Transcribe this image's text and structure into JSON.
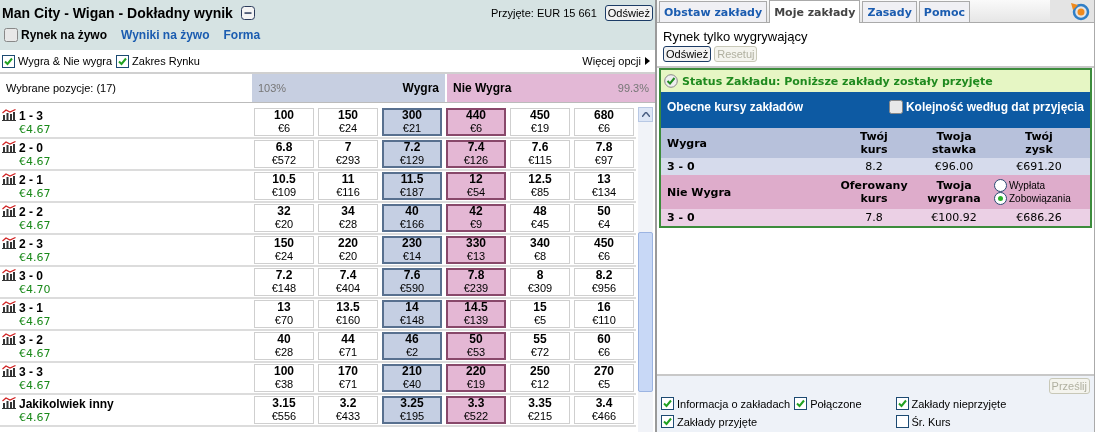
{
  "market": {
    "title": "Man City - Wigan - Dokładny wynik",
    "matched": "Przyjęte: EUR 15 661",
    "refresh": "Odśwież"
  },
  "live": {
    "label": "Rynek na żywo",
    "checked": false
  },
  "links": [
    "Wyniki na żywo",
    "Forma"
  ],
  "filters": [
    {
      "label": "Wygra & Nie wygra",
      "checked": true
    },
    {
      "label": "Zakres Rynku",
      "checked": true
    }
  ],
  "more_options": "Więcej opcji",
  "header": {
    "selections": "Wybrane pozycje:  (17)",
    "back_percent": "103%",
    "back": "Wygra",
    "lay": "Nie Wygra",
    "lay_percent": "99.3%"
  },
  "rows": [
    {
      "name": "1 - 3",
      "total": "€4.67",
      "cells": [
        [
          "100",
          "€6"
        ],
        [
          "150",
          "€24"
        ],
        [
          "300",
          "€21"
        ],
        [
          "440",
          "€6"
        ],
        [
          "450",
          "€19"
        ],
        [
          "680",
          "€6"
        ]
      ]
    },
    {
      "name": "2 - 0",
      "total": "€4.67",
      "cells": [
        [
          "6.8",
          "€572"
        ],
        [
          "7",
          "€293"
        ],
        [
          "7.2",
          "€129"
        ],
        [
          "7.4",
          "€126"
        ],
        [
          "7.6",
          "€115"
        ],
        [
          "7.8",
          "€97"
        ]
      ]
    },
    {
      "name": "2 - 1",
      "total": "€4.67",
      "cells": [
        [
          "10.5",
          "€109"
        ],
        [
          "11",
          "€116"
        ],
        [
          "11.5",
          "€187"
        ],
        [
          "12",
          "€54"
        ],
        [
          "12.5",
          "€85"
        ],
        [
          "13",
          "€134"
        ]
      ]
    },
    {
      "name": "2 - 2",
      "total": "€4.67",
      "cells": [
        [
          "32",
          "€20"
        ],
        [
          "34",
          "€28"
        ],
        [
          "40",
          "€166"
        ],
        [
          "42",
          "€9"
        ],
        [
          "48",
          "€45"
        ],
        [
          "50",
          "€4"
        ]
      ]
    },
    {
      "name": "2 - 3",
      "total": "€4.67",
      "cells": [
        [
          "150",
          "€24"
        ],
        [
          "220",
          "€20"
        ],
        [
          "230",
          "€14"
        ],
        [
          "330",
          "€13"
        ],
        [
          "340",
          "€8"
        ],
        [
          "450",
          "€6"
        ]
      ]
    },
    {
      "name": "3 - 0",
      "total": "€4.70",
      "cells": [
        [
          "7.2",
          "€148"
        ],
        [
          "7.4",
          "€404"
        ],
        [
          "7.6",
          "€590"
        ],
        [
          "7.8",
          "€239"
        ],
        [
          "8",
          "€309"
        ],
        [
          "8.2",
          "€956"
        ]
      ]
    },
    {
      "name": "3 - 1",
      "total": "€4.67",
      "cells": [
        [
          "13",
          "€70"
        ],
        [
          "13.5",
          "€160"
        ],
        [
          "14",
          "€148"
        ],
        [
          "14.5",
          "€139"
        ],
        [
          "15",
          "€5"
        ],
        [
          "16",
          "€110"
        ]
      ]
    },
    {
      "name": "3 - 2",
      "total": "€4.67",
      "cells": [
        [
          "40",
          "€28"
        ],
        [
          "44",
          "€71"
        ],
        [
          "46",
          "€2"
        ],
        [
          "50",
          "€53"
        ],
        [
          "55",
          "€72"
        ],
        [
          "60",
          "€6"
        ]
      ]
    },
    {
      "name": "3 - 3",
      "total": "€4.67",
      "cells": [
        [
          "100",
          "€38"
        ],
        [
          "170",
          "€71"
        ],
        [
          "210",
          "€40"
        ],
        [
          "220",
          "€19"
        ],
        [
          "250",
          "€12"
        ],
        [
          "270",
          "€5"
        ]
      ]
    },
    {
      "name": "Jakikolwiek inny",
      "total": "€4.67",
      "cells": [
        [
          "3.15",
          "€556"
        ],
        [
          "3.2",
          "€433"
        ],
        [
          "3.25",
          "€195"
        ],
        [
          "3.3",
          "€522"
        ],
        [
          "3.35",
          "€215"
        ],
        [
          "3.4",
          "€466"
        ]
      ]
    }
  ],
  "tabs": [
    {
      "label": "Obstaw zakłady",
      "selected": false
    },
    {
      "label": "Moje zakłady",
      "selected": true
    },
    {
      "label": "Zasady",
      "selected": false
    },
    {
      "label": "Pomoc",
      "selected": false
    }
  ],
  "my_bets": {
    "title": "Rynek tylko wygrywający",
    "buttons": [
      {
        "label": "Odśwież",
        "disabled": false
      },
      {
        "label": "Resetuj",
        "disabled": true
      }
    ],
    "status": "Status Zakładu: Poniższe zakłady zostały przyjęte",
    "current": "Obecne kursy zakładów",
    "order": {
      "label": "Kolejność według dat przyjęcia",
      "checked": false
    },
    "back": {
      "title": "Wygra",
      "columns": [
        "Twój kurs",
        "Twoja stawka",
        "Twój zysk"
      ],
      "rows": [
        {
          "selection": "3 - 0",
          "odds": "8.2",
          "stake": "€96.00",
          "result": "€691.20"
        }
      ]
    },
    "lay": {
      "title": "Nie Wygra",
      "columns": [
        "Oferowany kurs",
        "Twoja wygrana"
      ],
      "options": [
        {
          "label": "Wypłata",
          "selected": false
        },
        {
          "label": "Zobowiązania",
          "selected": true
        }
      ],
      "rows": [
        {
          "selection": "3 - 0",
          "odds": "7.8",
          "stake": "€100.92",
          "result": "€686.26"
        }
      ]
    }
  },
  "footer": {
    "submit": {
      "label": "Prześlij",
      "disabled": true
    },
    "options": [
      [
        {
          "label": "Informacja o zakładach",
          "checked": true
        },
        {
          "label": "Połączone",
          "checked": true
        },
        {
          "label": "Zakłady nieprzyjęte",
          "checked": true
        }
      ],
      [
        {
          "label": "Zakłady przyjęte",
          "checked": true
        },
        {
          "label": "Śr. Kurs",
          "checked": false
        }
      ]
    ]
  }
}
